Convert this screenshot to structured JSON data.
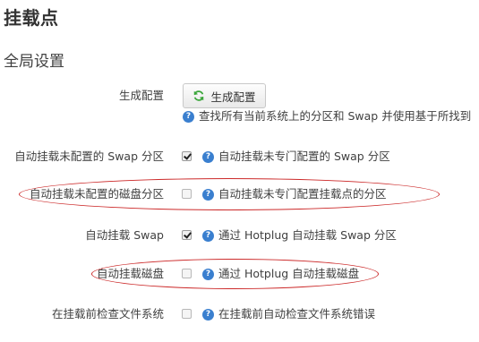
{
  "page": {
    "title": "挂载点",
    "section_title": "全局设置"
  },
  "generate": {
    "label": "生成配置",
    "button_label": "生成配置",
    "help": "查找所有当前系统上的分区和 Swap 并使用基于所找到"
  },
  "options": [
    {
      "label": "自动挂载未配置的 Swap 分区",
      "checked": true,
      "help": "自动挂载未专门配置的 Swap 分区"
    },
    {
      "label": "自动挂载未配置的磁盘分区",
      "checked": false,
      "help": "自动挂载未专门配置挂载点的分区"
    },
    {
      "label": "自动挂载 Swap",
      "checked": true,
      "help": "通过 Hotplug 自动挂载 Swap 分区"
    },
    {
      "label": "自动挂载磁盘",
      "checked": false,
      "help": "通过 Hotplug 自动挂载磁盘"
    },
    {
      "label": "在挂载前检查文件系统",
      "checked": false,
      "help": "在挂载前自动检查文件系统错误"
    }
  ],
  "icons": {
    "refresh": "refresh-icon",
    "help": "question-circle-icon"
  },
  "colors": {
    "accent": "#3a7fcf",
    "annotation": "#cc2a2a",
    "refresh_green": "#3aa53a"
  }
}
